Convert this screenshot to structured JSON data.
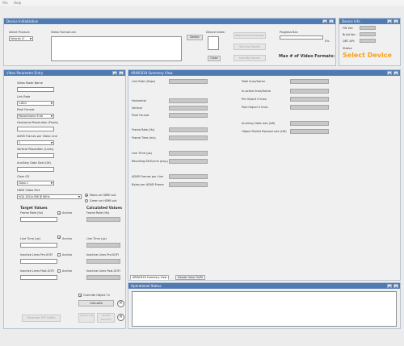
{
  "menu": [
    "File",
    "Help"
  ],
  "device_init": {
    "title": "Device Initialization",
    "select_product_label": "Select Product:",
    "select_product_value": "Velocity IC",
    "video_format_list_label": "Video Format List:",
    "delete_label": "Delete",
    "device_index_label": "Device Index:",
    "close_label": "Close",
    "reserve_label": "Reserve from Device",
    "send_label": "Send to Device",
    "identify_label": "Identify Device",
    "progress_label": "Progress Bar:",
    "progress_text": "0%",
    "progress_value": 0,
    "max_formats_label": "Max # of Video Formats:"
  },
  "device_info": {
    "title": "Device Info",
    "fw_label": "FW Ver:",
    "build_label": "Build Ver:",
    "qbt_label": "QBT API:",
    "status_label": "Status:",
    "status_value": "Select Device",
    "status_color": "#f5a020"
  },
  "video_param": {
    "title": "Video Parameter Entry",
    "mode_name_label": "Video Mode Name",
    "link_rate_label": "Link Rate",
    "link_rate_value": "1.62G",
    "pixel_format_label": "Pixel Format",
    "pixel_format_value": "Monochrome 8 bit",
    "hres_label": "Horizontal Resolution (Pixels)",
    "lanes_label": "ADVB Frames per Video Line",
    "lanes_value": "1",
    "vres_label": "Vertical Resolution (Lines)",
    "ancillary_label": "Ancillary Data Size (LW)",
    "class_label": "Class OS",
    "class_value": "Class 1",
    "hdmi_port_label": "HDMI Video Port",
    "hdmi_port_value": "VGA 1024x768 @ 60Hz",
    "mono_hdmi": "Mono on HDMI out",
    "green_hdmi": "Green on HDMI out",
    "target_title": "Target Values",
    "calc_title": "Calculated Values",
    "frame_rate_label": "Frame Rate (Hz)",
    "line_time_label": "Line Time (µs)",
    "inactive_pre_label": "Inactive Lines Pre-SOFI",
    "inactive_post_label": "Inactive Lines Post-SOFI",
    "anchor_label": "Anchor",
    "override_label": "Override Object Tx",
    "calculate_label": "Calculate",
    "add_list_label": "Add to List",
    "update_label": "Update Selected",
    "gen_label": "Generate VFS Profile"
  },
  "summary": {
    "title": "ARINC818 Summary View",
    "left_fields": [
      "Link Rate (Gbps)",
      "Horizontal",
      "Vertical",
      "Pixel Format",
      "Frame Rate (Hz)",
      "Frame Time (ms)",
      "Line Time (µs)",
      "Resulting IDLE/Line (avg.)",
      "ADVB Frames per Line",
      "Bytes per ADVB Frame"
    ],
    "right_fields": [
      "Total lines/frame",
      "In-active lines/frame",
      "Pre Object 0 lines",
      "Post Object 0 lines",
      "Ancillary  Data size (LW)",
      "Object Packet Payload size (LW)"
    ],
    "tab1": "ARINC818 Summary View",
    "tab2": "Header View TU/RI"
  },
  "op_status": {
    "title": "Operational Status"
  }
}
